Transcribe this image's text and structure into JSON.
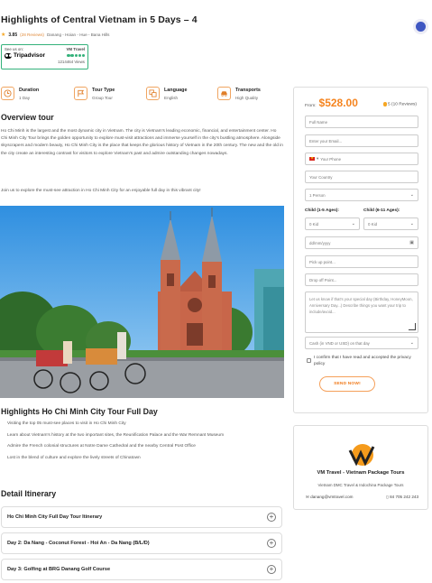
{
  "header": {
    "title": "Highlights of Central Vietnam in 5 Days – 4",
    "rating": "3.85",
    "reviews": "(28 Reviews)",
    "route": "Danang - Hoian - Hue - Bana Hills"
  },
  "tripadvisor": {
    "see_us_on": "See us on:",
    "brand": "Tripadvisor",
    "company": "VM Travel",
    "views": "1214464 Views"
  },
  "features": [
    {
      "label": "Duration",
      "value": "1 Day",
      "icon": "clock-icon"
    },
    {
      "label": "Tour Type",
      "value": "Group Tour",
      "icon": "flag-icon"
    },
    {
      "label": "Language",
      "value": "English",
      "icon": "translate-icon"
    },
    {
      "label": "Transports",
      "value": "High Quality",
      "icon": "car-icon"
    }
  ],
  "overview": {
    "heading": "Overview tour",
    "paragraph1": "Ho Chi Minh is the largest and the most dynamic city in Vietnam. The city is Vietnam's leading economic, financial, and entertainment center. Ho Chi Minh City Tour brings the golden opportunity to explore must-visit attractions and immerse yourself in the city's bustling atmosphere. Alongside skyscrapers and modern beauty, Ho Chi Minh City is the place that keeps the glorious history of Vietnam in the 20th century. The new and the old in the city create an interesting contrast for visitors to explore Vietnam's past and admire outstanding changes nowadays.",
    "paragraph2": "Join us to explore the must-see attraction in Ho Chi Minh City for an enjoyable full day in this vibrant city!"
  },
  "highlights": {
    "heading": "Highlights Ho Chi Minh City Tour Full Day",
    "items": [
      "Visiting the top 05 must-see places to visit in Ho Chi Minh City",
      "Learn about Vietnam's history at the two important sites, the Reunification Palace and the War Remnant Museum",
      "Admire the French colonial structures at Notre Dame Cathedral and the nearby Central Post Office",
      "Lost in the blend of culture and explore the lively streets of Chinatown"
    ]
  },
  "itinerary": {
    "heading": "Detail Itinerary",
    "items": [
      "Ho Chi Minh City Full Day Tour Itinerary",
      "Day 2: Da Nang - Coconut Forest - Hoi An - Da Nang (B/L/D)",
      "Day 3: Golfing at BRG Danang Golf Course"
    ]
  },
  "booking": {
    "from": "From:",
    "price": "$528.00",
    "rating": "5 (10 Reviews)",
    "full_name": "Full Name",
    "email": "Enter your Email...",
    "phone": "Your Phone",
    "phone_prefix": "▾",
    "country": "Your Country",
    "person": "1 Person",
    "child1_label": "Child (1-5 Ages):",
    "child2_label": "Child (6-11 Ages):",
    "child1": "0 Kid",
    "child2": "0 Kid",
    "date": "dd/mm/yyyy",
    "pickup": "Pick up point...",
    "dropoff": "Drop off Point...",
    "message": "Let us know if that's your special day (Birthday, HoneyMoon, Anniversary Day...) Describe things you want your trip to include/avoid...",
    "payment": "Cash (in VND or USD) on that day",
    "agree": "I confirm that I have read and accepted the privacy policy",
    "send": "SEND NOW!"
  },
  "company_card": {
    "name": "VM Travel - Vietnam Package Tours",
    "subtitle": "Vietnam DMC Travel & Indochina Package Tours",
    "email": "danang@vmtravel.com",
    "phone": "84 705 242 243"
  },
  "colors": {
    "accent": "#f5841f",
    "tripadvisor_green": "#34b27b",
    "fab_blue": "#3f57c2"
  }
}
